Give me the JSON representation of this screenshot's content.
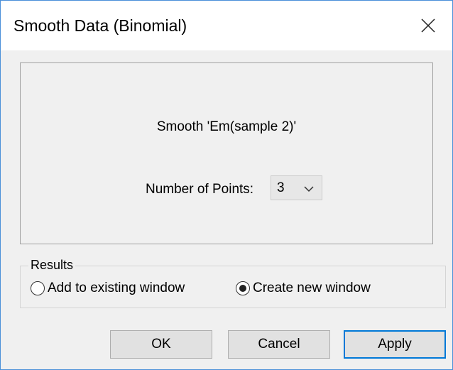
{
  "window": {
    "title": "Smooth Data (Binomial)"
  },
  "panel": {
    "smooth_text": "Smooth 'Em(sample 2)'",
    "points_label": "Number of Points:",
    "points_value": "3"
  },
  "results": {
    "legend": "Results",
    "options": [
      {
        "label": "Add to existing window",
        "selected": false
      },
      {
        "label": "Create new window",
        "selected": true
      }
    ]
  },
  "buttons": {
    "ok": "OK",
    "cancel": "Cancel",
    "apply": "Apply"
  },
  "colors": {
    "accent": "#0078d7",
    "window_border": "#4a90d9"
  },
  "icons": {
    "close": "close-icon",
    "dropdown": "chevron-down-icon"
  }
}
